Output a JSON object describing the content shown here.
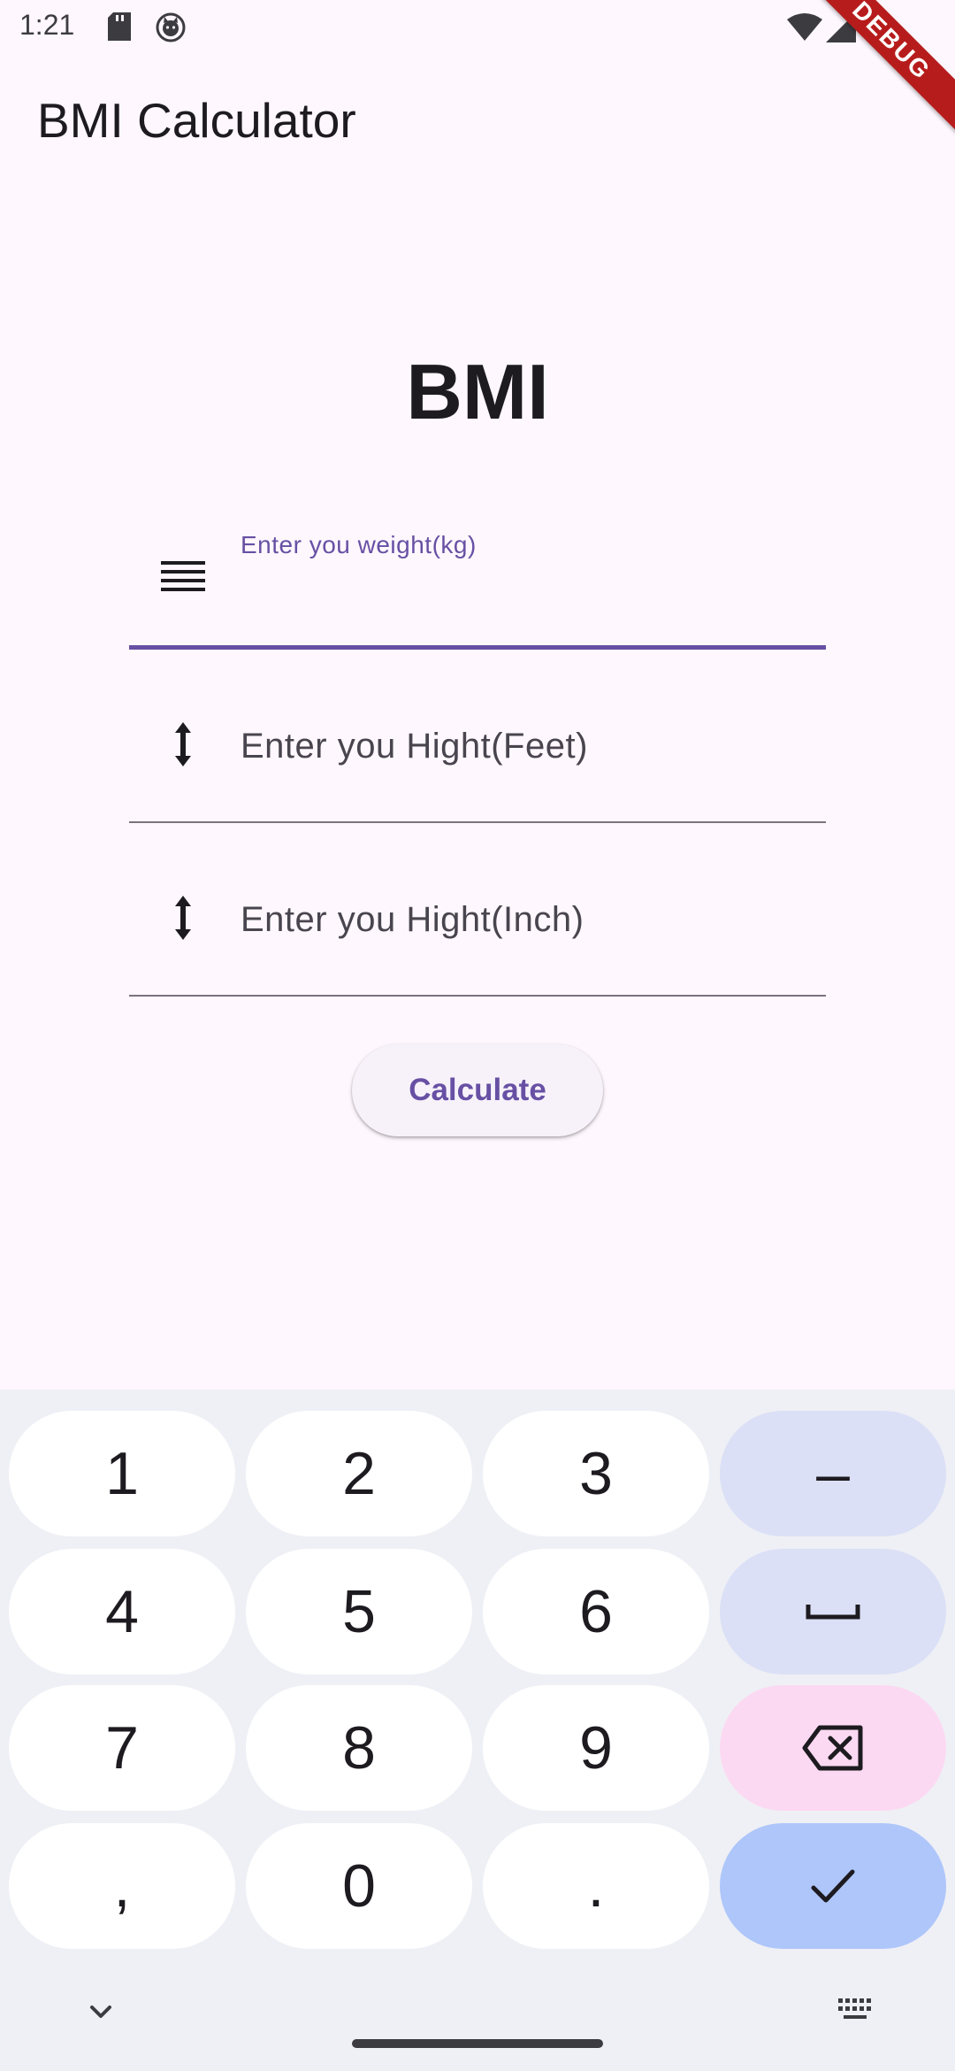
{
  "status_bar": {
    "time": "1:21",
    "icons": [
      "sd-card-icon",
      "cat-icon",
      "wifi-icon",
      "signal-icon",
      "battery-icon"
    ]
  },
  "debug_banner": "DEBUG",
  "app_bar": {
    "title": "BMI Calculator"
  },
  "main": {
    "heading": "BMI",
    "fields": [
      {
        "label": "Enter you weight(kg)",
        "value": "",
        "icon": "weight-lines-icon",
        "focused": true
      },
      {
        "placeholder": "Enter you Hight(Feet)",
        "value": "",
        "icon": "vertical-arrows-icon"
      },
      {
        "placeholder": "Enter you Hight(Inch)",
        "value": "",
        "icon": "vertical-arrows-icon"
      }
    ],
    "calculate_label": "Calculate"
  },
  "keyboard": {
    "keys": {
      "k1": "1",
      "k2": "2",
      "k3": "3",
      "minus": "–",
      "k4": "4",
      "k5": "5",
      "k6": "6",
      "k7": "7",
      "k8": "8",
      "k9": "9",
      "comma": ",",
      "k0": "0",
      "period": "."
    },
    "func_icons": [
      "space-icon",
      "backspace-icon",
      "check-icon",
      "chevron-down-icon",
      "keyboard-icon"
    ]
  },
  "colors": {
    "primary": "#6750a4",
    "background": "#fef7fd",
    "keyboard_bg": "#eff0f5",
    "func_key": "#dbe0f6",
    "delete_key": "#fcd9f2",
    "done_key": "#aec6fa",
    "debug_banner": "#b71c1c"
  }
}
